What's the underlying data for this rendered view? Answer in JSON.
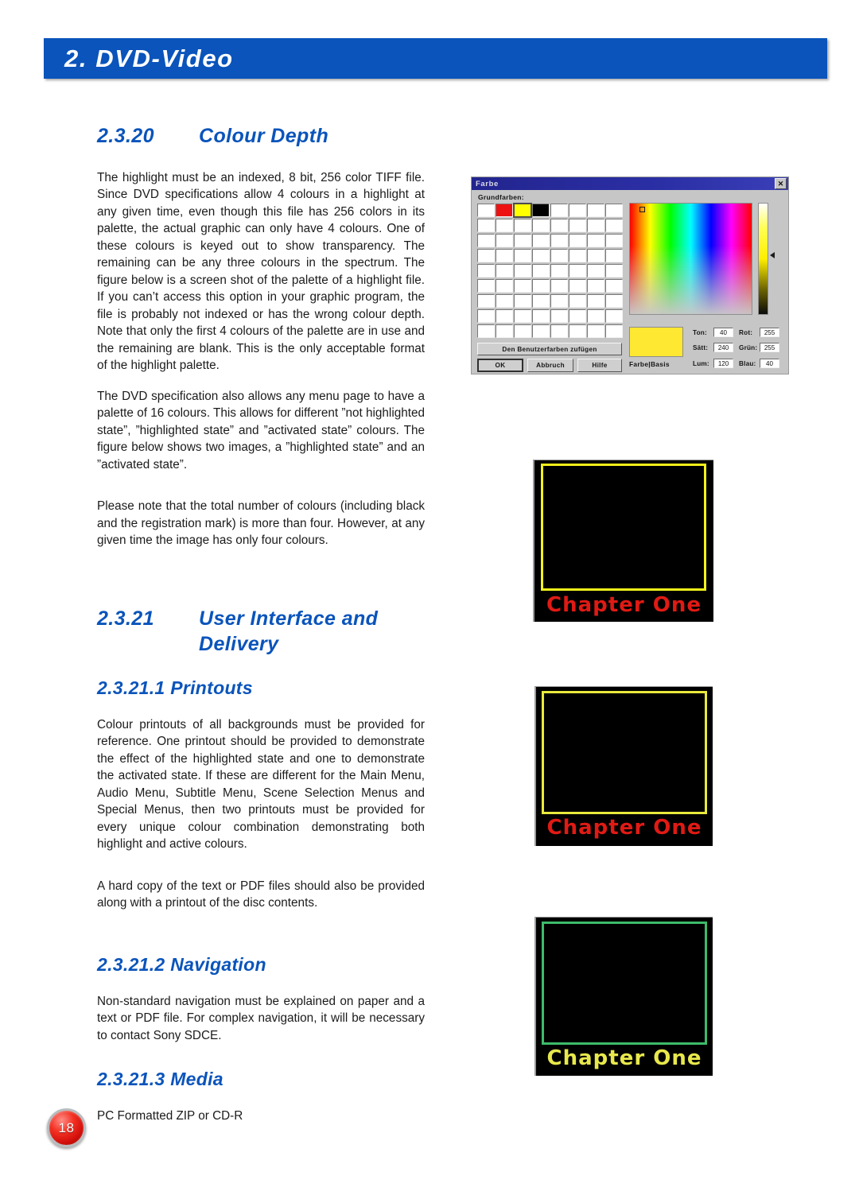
{
  "chapter_banner": {
    "title": "2. DVD-Video",
    "accent_color": "#0a54bb"
  },
  "sections": {
    "colour_depth": {
      "number": "2.3.20",
      "title": "Colour Depth",
      "paragraph_1": "The highlight must be an indexed, 8 bit, 256 color TIFF file. Since DVD specifications allow 4 colours in a highlight at any given time, even though this file has 256 colors in its palette, the actual graphic can only have 4 colours. One of these colours is keyed out to show transparency. The remaining can be any three colours in the spectrum. The figure below is a screen shot of the palette of a highlight file. If you can’t access this option in your graphic program, the file is probably not indexed or has the wrong colour depth. Note that only the first 4 colours of the palette are in  use and the remaining are blank. This is the only acceptable format of the highlight palette.",
      "paragraph_2": "The DVD specification also allows any menu page to have a palette of 16 colours. This allows for different ”not highlighted state”, ”highlighted state” and ”activated state” colours. The figure below shows two images, a ”highlighted state” and an ”activated state”.",
      "paragraph_3": "Please note that the total number of colours (including black and the registration mark) is more than four. However, at any given time the image has only four colours."
    },
    "user_interface": {
      "number": "2.3.21",
      "title": "User Interface and Delivery"
    },
    "printouts": {
      "heading": "2.3.21.1 Printouts",
      "paragraph_1": "Colour printouts of all backgrounds must be provided for reference. One printout should be provided to demonstrate the effect of the highlighted state and one to demonstrate the activated state. If these are different for the Main Menu, Audio Menu, Subtitle Menu, Scene Selection Menus and Special Menus, then two printouts must be provided for every unique colour combination demonstrating both highlight and active colours.",
      "paragraph_2": "A hard copy of the text or PDF files should also be provided along with a printout of the disc contents."
    },
    "navigation": {
      "heading": "2.3.21.2 Navigation",
      "paragraph_1": "Non-standard navigation must be explained on paper and a text or PDF file. For complex navigation, it will be necessary to contact Sony SDCE."
    },
    "media": {
      "heading": "2.3.21.3 Media",
      "paragraph_1": "PC Formatted ZIP or CD-R"
    }
  },
  "figure_colour_dialog": {
    "window_title": "Farbe",
    "close_glyph": "✕",
    "basic_colors_label": "Grundfarben:",
    "swatch_colors": [
      "#ffffff",
      "#ee1111",
      "#ffff00",
      "#000000",
      "#ffffff",
      "#ffffff",
      "#ffffff",
      "#ffffff",
      "#ffffff",
      "#ffffff",
      "#ffffff",
      "#ffffff",
      "#ffffff",
      "#ffffff",
      "#ffffff",
      "#ffffff",
      "#ffffff",
      "#ffffff",
      "#ffffff",
      "#ffffff",
      "#ffffff",
      "#ffffff",
      "#ffffff",
      "#ffffff",
      "#ffffff",
      "#ffffff",
      "#ffffff",
      "#ffffff",
      "#ffffff",
      "#ffffff",
      "#ffffff",
      "#ffffff",
      "#ffffff",
      "#ffffff",
      "#ffffff",
      "#ffffff",
      "#ffffff",
      "#ffffff",
      "#ffffff",
      "#ffffff",
      "#ffffff",
      "#ffffff",
      "#ffffff",
      "#ffffff",
      "#ffffff",
      "#ffffff",
      "#ffffff",
      "#ffffff",
      "#ffffff",
      "#ffffff",
      "#ffffff",
      "#ffffff",
      "#ffffff",
      "#ffffff",
      "#ffffff",
      "#ffffff",
      "#ffffff",
      "#ffffff",
      "#ffffff",
      "#ffffff",
      "#ffffff",
      "#ffffff",
      "#ffffff",
      "#ffffff",
      "#ffffff",
      "#ffffff",
      "#ffffff",
      "#ffffff",
      "#ffffff",
      "#ffffff",
      "#ffffff",
      "#ffffff"
    ],
    "selected_swatch_index": 2,
    "add_custom_button": "Den Benutzerfarben zufügen",
    "ok_button": "OK",
    "cancel_button": "Abbruch",
    "help_button": "Hilfe",
    "preview_label": "Farbe|Basis",
    "preview_color": "#ffe831",
    "hue_label": "Ton:",
    "hue_value": "40",
    "sat_label": "Sätt:",
    "sat_value": "240",
    "lum_label": "Lum:",
    "lum_value": "120",
    "red_label": "Rot:",
    "red_value": "255",
    "green_label": "Grün:",
    "green_value": "255",
    "blue_label": "Blau:",
    "blue_value": "40"
  },
  "figure_menus": [
    {
      "caption": "Chapter One",
      "frame_color": "#f2f21b",
      "text_color": "#e01a14"
    },
    {
      "caption": "Chapter One",
      "frame_color": "#e9e93c",
      "text_color": "#e01a14"
    },
    {
      "caption": "Chapter One",
      "frame_color": "#3dbb6a",
      "text_color": "#e8e84c"
    }
  ],
  "page_number": "18"
}
